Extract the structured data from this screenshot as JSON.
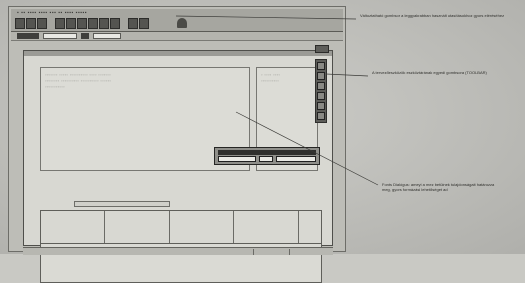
{
  "callouts": {
    "toolbar_note": "Változtatható gombsor a leggyakrabban használt utasításokhoz gyors eléréséhez",
    "toolstrip_note": "A tervezőeszközök eszköztárának egyedi gombsora (TOOLBAR)",
    "font_dialog_note": "Fonts Dialógus: ameyi a mez betüinek tulajdonságait határozza meg, gyors formázási lehetőséget ad"
  }
}
